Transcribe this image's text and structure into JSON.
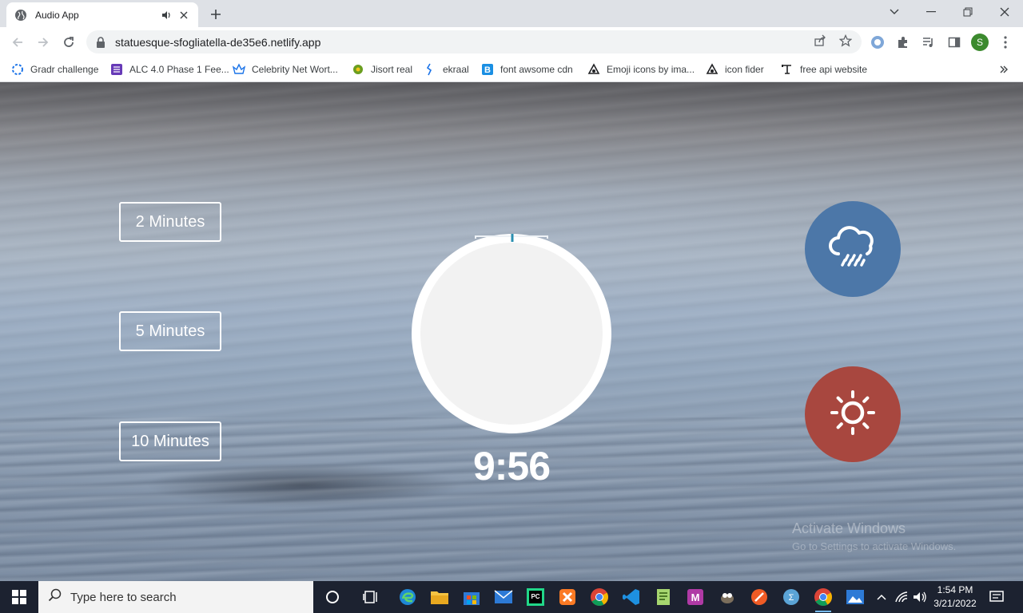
{
  "browser": {
    "tab_title": "Audio App",
    "url": "statuesque-sfogliatella-de35e6.netlify.app",
    "avatar_letter": "S",
    "bookmarks": [
      {
        "label": "Gradr challenge",
        "icon": "gradr-icon"
      },
      {
        "label": "ALC 4.0 Phase 1 Fee...",
        "icon": "form-icon"
      },
      {
        "label": "Celebrity Net Wort...",
        "icon": "crown-icon"
      },
      {
        "label": "Jisort real",
        "icon": "jisort-icon"
      },
      {
        "label": "ekraal",
        "icon": "ekraal-icon"
      },
      {
        "label": "font awsome cdn",
        "icon": "b-icon"
      },
      {
        "label": "Emoji icons by ima...",
        "icon": "emoji-icon"
      },
      {
        "label": "icon fider",
        "icon": "iconfinder-icon"
      },
      {
        "label": "free api website",
        "icon": "api-icon"
      }
    ]
  },
  "app": {
    "time_options": [
      "2 Minutes",
      "5 Minutes",
      "10 Minutes"
    ],
    "time_display": "9:56",
    "progress": 0.007,
    "sound_buttons": [
      {
        "name": "rain-sound-button",
        "icon": "rain-cloud-icon",
        "color": "#4c77a8"
      },
      {
        "name": "sun-sound-button",
        "icon": "sun-icon",
        "color": "#a8473f"
      }
    ]
  },
  "watermark": {
    "title": "Activate Windows",
    "subtitle": "Go to Settings to activate Windows."
  },
  "taskbar": {
    "search_placeholder": "Type here to search",
    "time": "1:54 PM",
    "date": "3/21/2022"
  }
}
